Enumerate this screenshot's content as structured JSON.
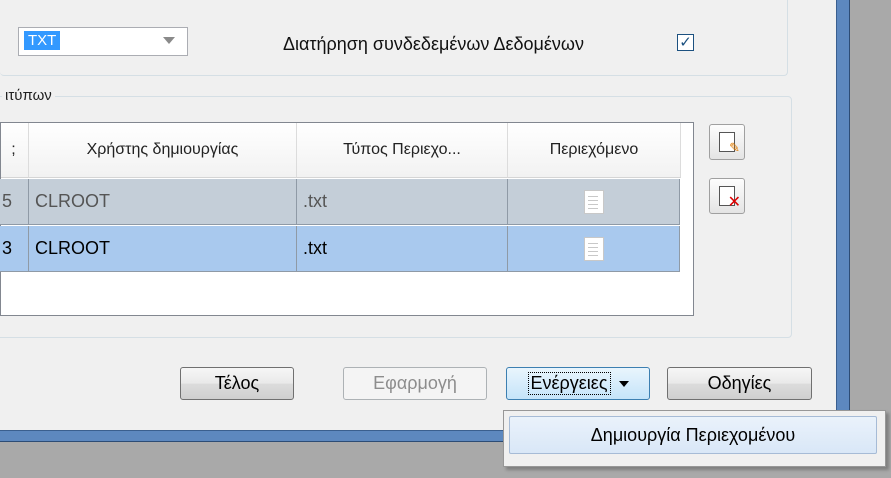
{
  "options": {
    "format_value": "TXT",
    "keep_linked_label": "Διατήρηση συνδεδεμένων Δεδομένων",
    "keep_linked_checked": true
  },
  "attachments_group": {
    "legend": "ιτύπων",
    "columns": [
      {
        "label": ";"
      },
      {
        "label": "Χρήστης δημιουργίας"
      },
      {
        "label": "Τύπος Περιεχο..."
      },
      {
        "label": "Περιεχόμενο"
      }
    ],
    "rows": [
      {
        "id_fragment": "5",
        "creator": "CLROOT",
        "type": ".txt",
        "content_icon": "text-document-icon",
        "selected": false
      },
      {
        "id_fragment": "3",
        "creator": "CLROOT",
        "type": ".txt",
        "content_icon": "text-document-icon",
        "selected": true
      }
    ]
  },
  "buttons": {
    "finish": "Τέλος",
    "apply": "Εφαρμογή",
    "actions": "Ενέργειες",
    "help": "Οδηγίες"
  },
  "actions_menu": {
    "items": [
      {
        "label": "Δημιουργία Περιεχομένου"
      }
    ]
  },
  "icons": {
    "add": "new-content-icon",
    "delete": "delete-content-icon"
  },
  "colors": {
    "selected_row": "#a9c9ee",
    "inactive_row": "#c4ced8",
    "window_frame": "#5d88bf"
  }
}
